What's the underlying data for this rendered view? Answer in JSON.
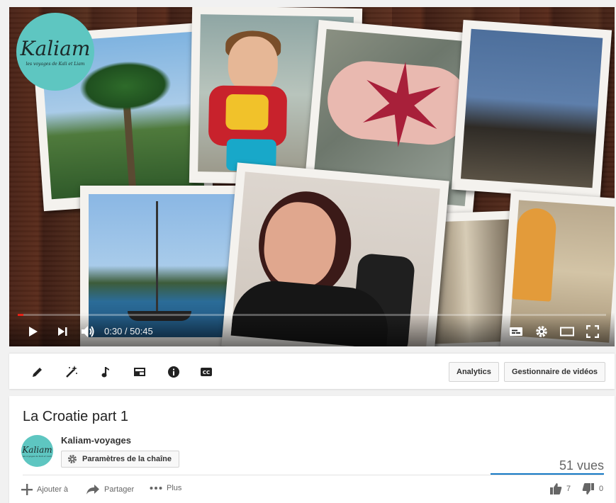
{
  "player": {
    "logo_word": "Kaliam",
    "logo_tagline": "les voyages de Kali et Liam",
    "current_time": "0:30",
    "time_separator": " / ",
    "duration": "50:45",
    "progress_fraction": 0.0099
  },
  "toolbar": {
    "icons": [
      "edit-icon",
      "enhance-icon",
      "audio-icon",
      "annotations-icon",
      "info-icon",
      "subtitles-icon"
    ],
    "analytics_label": "Analytics",
    "manager_label": "Gestionnaire de vidéos"
  },
  "video": {
    "title": "La Croatie part 1",
    "channel_name": "Kaliam-voyages",
    "channel_settings_label": "Paramètres de la chaîne",
    "views": "51 vues",
    "add_to_label": "Ajouter à",
    "share_label": "Partager",
    "more_label": "Plus",
    "likes": "7",
    "dislikes": "0"
  },
  "colors": {
    "accent_red": "#e62117",
    "accent_blue": "#167ac6",
    "logo_teal": "#5ec6c1"
  }
}
